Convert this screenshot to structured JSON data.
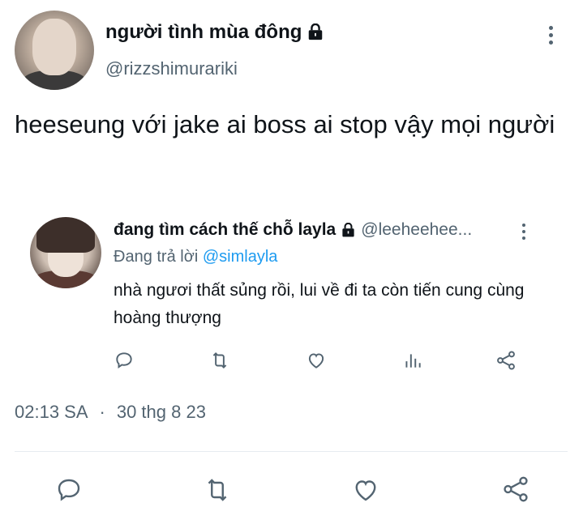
{
  "author": {
    "name": "người tình mùa đông",
    "handle": "@rizzshimurariki",
    "lock_icon": "lock-icon",
    "avatar": "avatar"
  },
  "tweet": {
    "text": "heeseung với jake ai boss ai stop vậy mọi người"
  },
  "quoted_reply": {
    "name": "đang tìm cách thế chỗ layla",
    "handle": "@leeheehee...",
    "replying_prefix": "Đang trả lời",
    "replying_to": "@simlayla",
    "text": "nhà ngươi thất sủng rồi, lui về đi ta còn tiến cung cùng hoàng thượng",
    "actions": [
      "reply-icon",
      "retweet-icon",
      "like-icon",
      "views-icon",
      "share-icon"
    ]
  },
  "meta": {
    "time": "02:13 SA",
    "separator": "·",
    "date": "30 thg 8 23"
  },
  "main_actions": [
    "reply-icon",
    "retweet-icon",
    "like-icon",
    "share-icon"
  ],
  "colors": {
    "text": "#0f1419",
    "secondary": "#536471",
    "link": "#1d9bf0"
  }
}
